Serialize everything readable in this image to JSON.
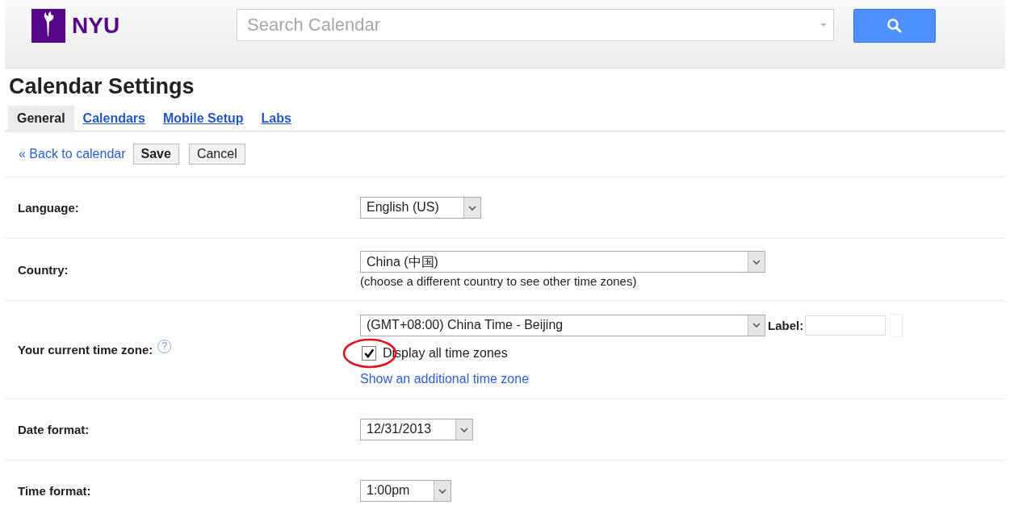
{
  "header": {
    "logo_text": "NYU",
    "search": {
      "placeholder": "Search Calendar"
    }
  },
  "title": "Calendar Settings",
  "tabs": [
    {
      "label": "General",
      "selected": true
    },
    {
      "label": "Calendars",
      "selected": false
    },
    {
      "label": "Mobile Setup",
      "selected": false
    },
    {
      "label": "Labs",
      "selected": false
    }
  ],
  "actions": {
    "back_link": "« Back to calendar",
    "buttons": [
      "Save",
      "Cancel"
    ]
  },
  "settings": [
    {
      "kind": "select",
      "label": "Language:",
      "value": "English (US)"
    },
    {
      "kind": "country",
      "label": "Country:",
      "value": "China (中国)",
      "note": "(choose a different country to see other time zones)"
    },
    {
      "kind": "timezone",
      "label": "Your current time zone:",
      "help": "?",
      "value": "(GMT+08:00) China Time - Beijing",
      "field_label": "Label:",
      "checkbox": {
        "label": "Display all time zones",
        "checked": true
      },
      "link": "Show an additional time zone"
    },
    {
      "kind": "select",
      "label": "Date format:",
      "value": "12/31/2013"
    },
    {
      "kind": "select",
      "label": "Time format:",
      "value": "1:00pm"
    }
  ]
}
